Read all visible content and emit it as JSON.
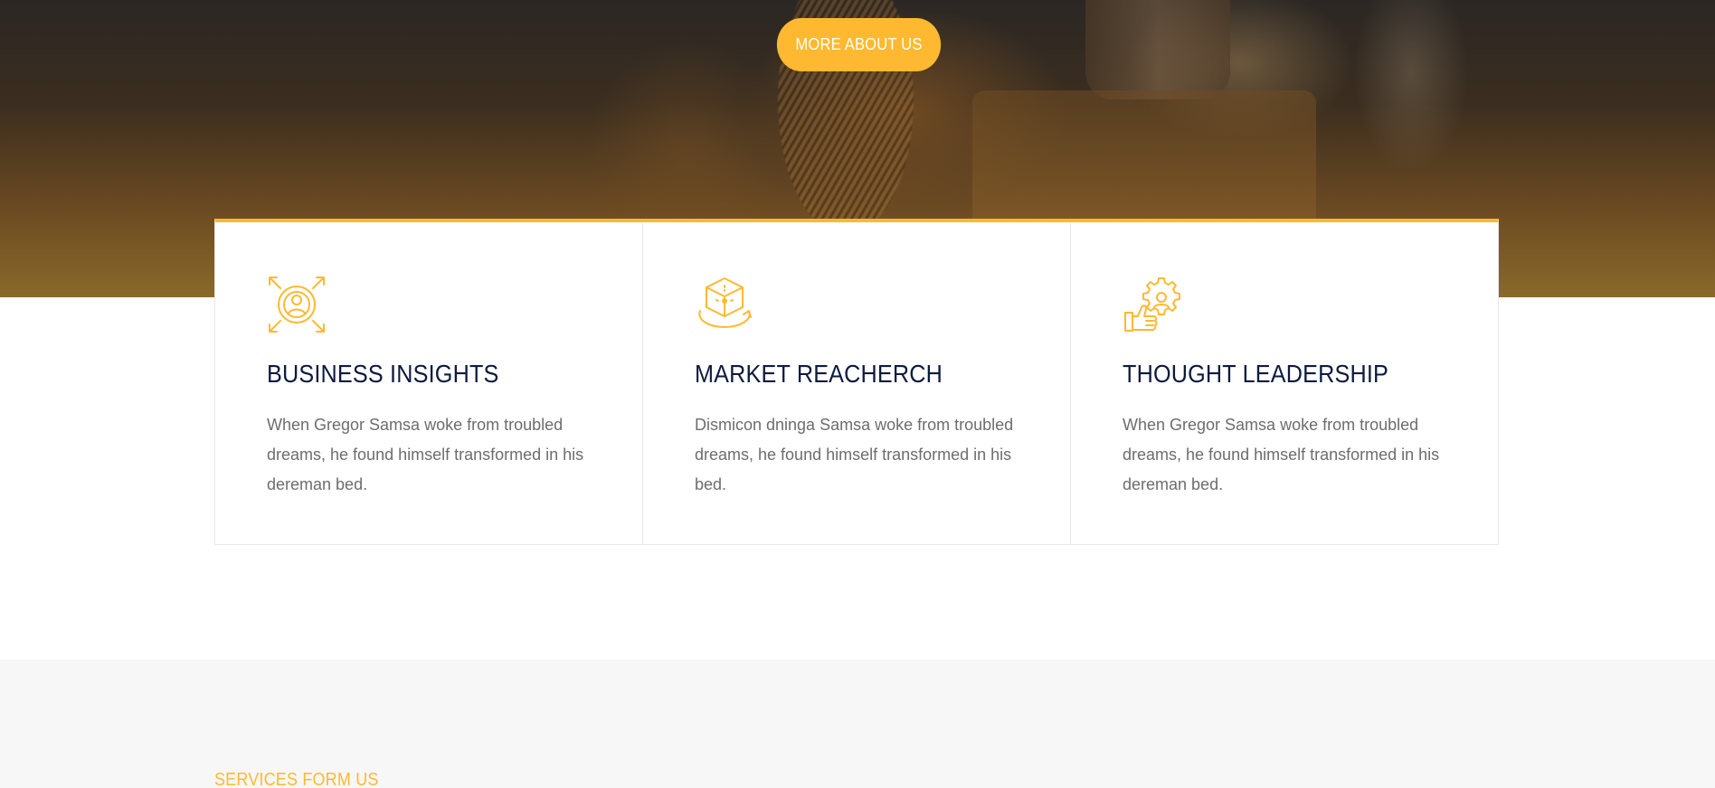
{
  "hero": {
    "button_label": "MORE ABOUT US"
  },
  "features": [
    {
      "icon": "business-insights-icon",
      "title": "BUSINESS INSIGHTS",
      "text": "When Gregor Samsa woke from troubled dreams, he found himself transformed in his dereman bed."
    },
    {
      "icon": "market-research-icon",
      "title": "MARKET REACHERCH",
      "text": "Dismicon dninga Samsa woke from troubled dreams, he found himself transformed in his bed."
    },
    {
      "icon": "thought-leadership-icon",
      "title": "THOUGHT LEADERSHIP",
      "text": "When Gregor Samsa woke from troubled dreams, he found himself transformed in his dereman bed."
    }
  ],
  "services": {
    "subtitle": "SERVICES FORM US"
  },
  "colors": {
    "accent": "#ffb930",
    "heading": "#0d1b3e",
    "body_text": "#6d6d6d",
    "section_bg": "#f7f7f7"
  }
}
